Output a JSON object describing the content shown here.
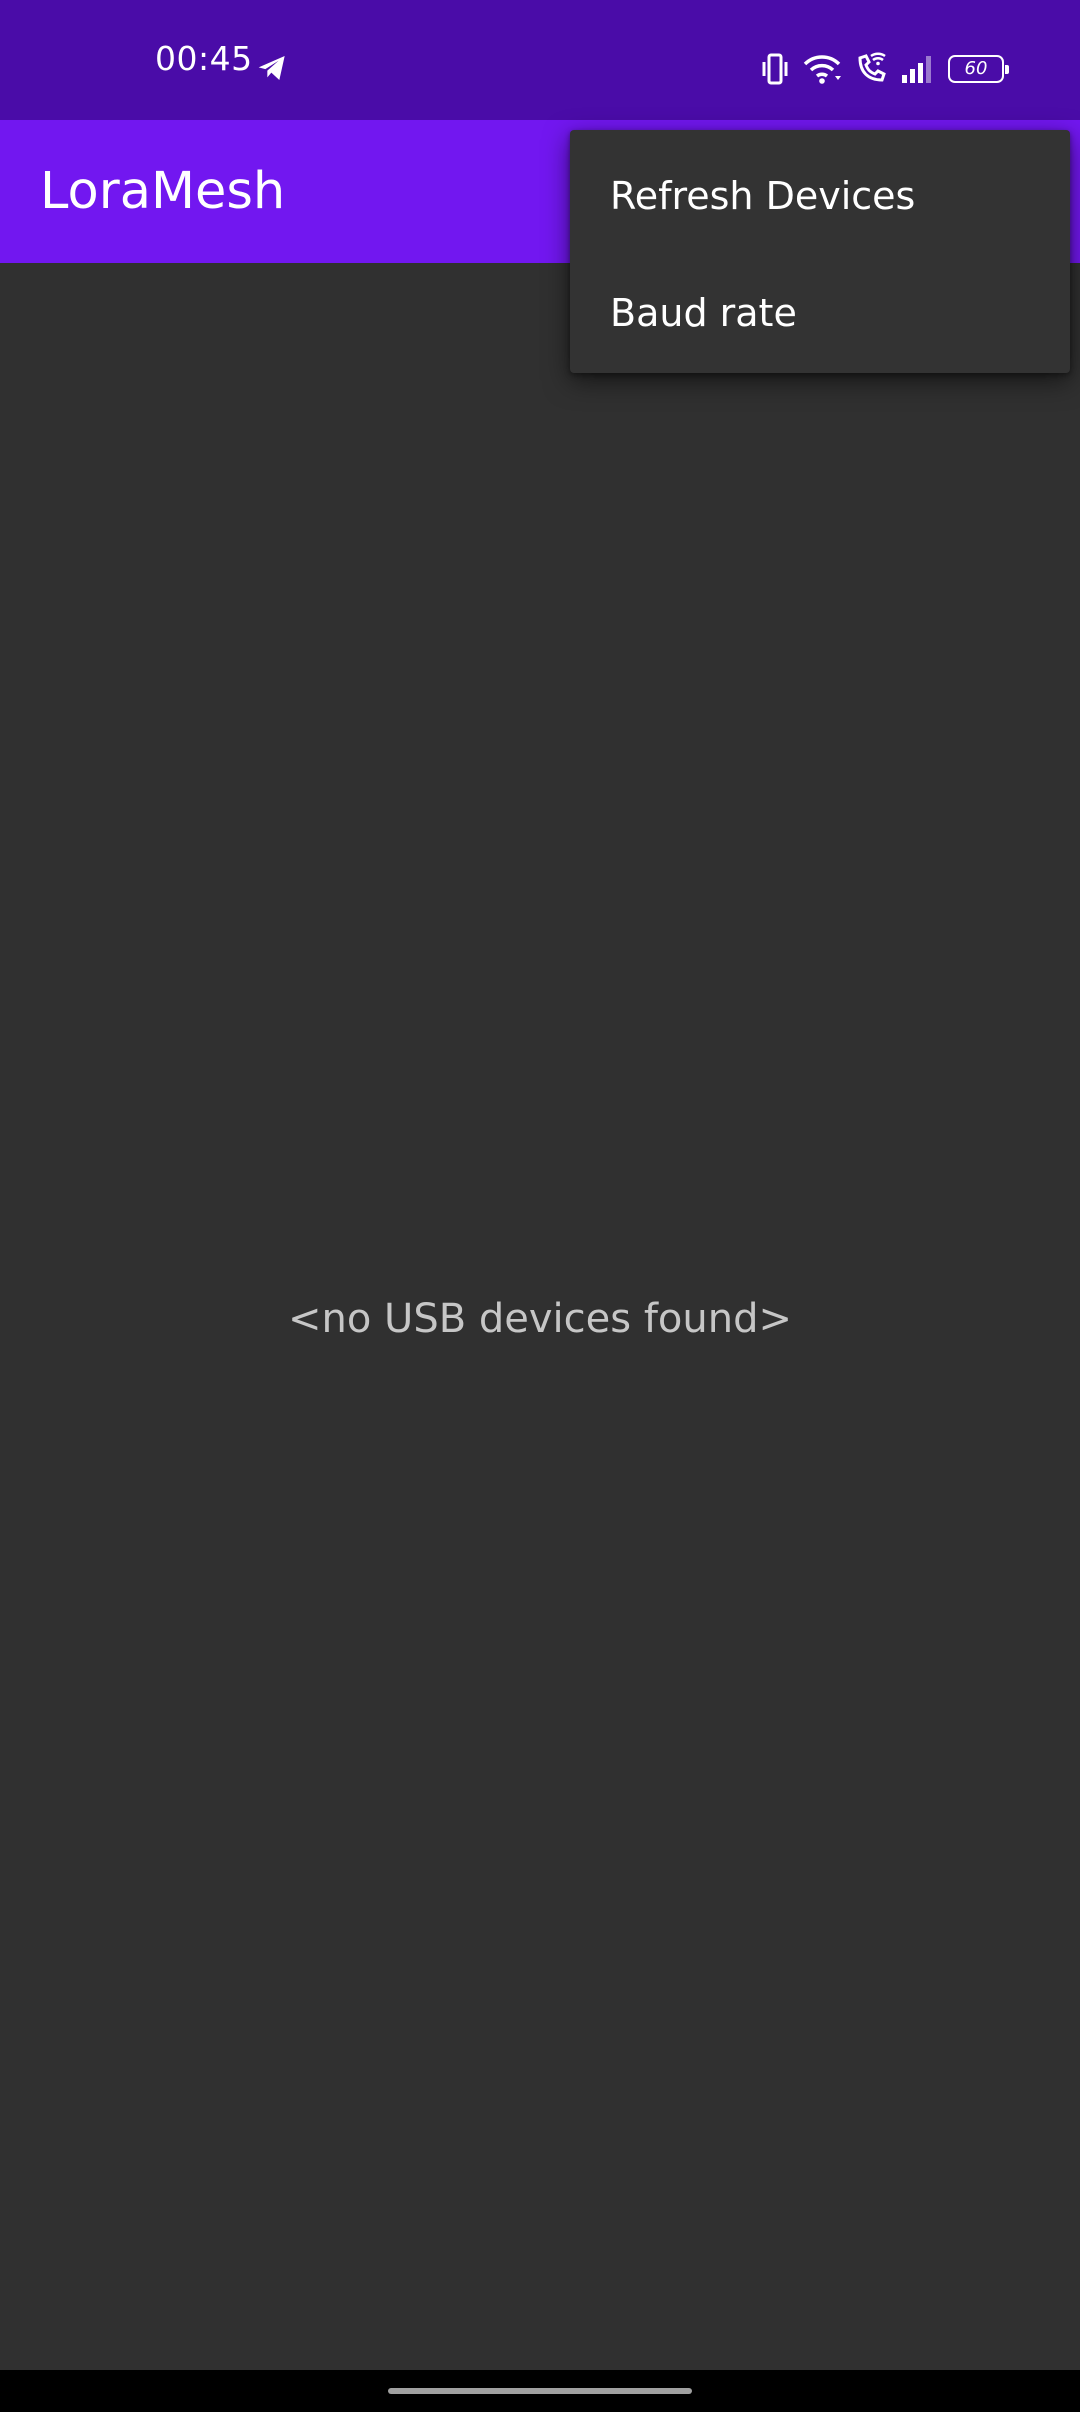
{
  "status_bar": {
    "time": "00:45",
    "battery_level": "60",
    "icons": [
      "telegram-icon",
      "vibrate-icon",
      "wifi-icon",
      "wifi-calling-icon",
      "signal-icon",
      "battery-icon"
    ]
  },
  "app_bar": {
    "title": "LoraMesh",
    "background_color": "#7217f0"
  },
  "menu": {
    "items": [
      {
        "label": "Refresh Devices"
      },
      {
        "label": "Baud rate"
      }
    ]
  },
  "content": {
    "empty_message": "<no USB devices found>"
  },
  "colors": {
    "status_bar": "#4a0ca8",
    "background": "#303030",
    "menu_background": "#333333"
  }
}
